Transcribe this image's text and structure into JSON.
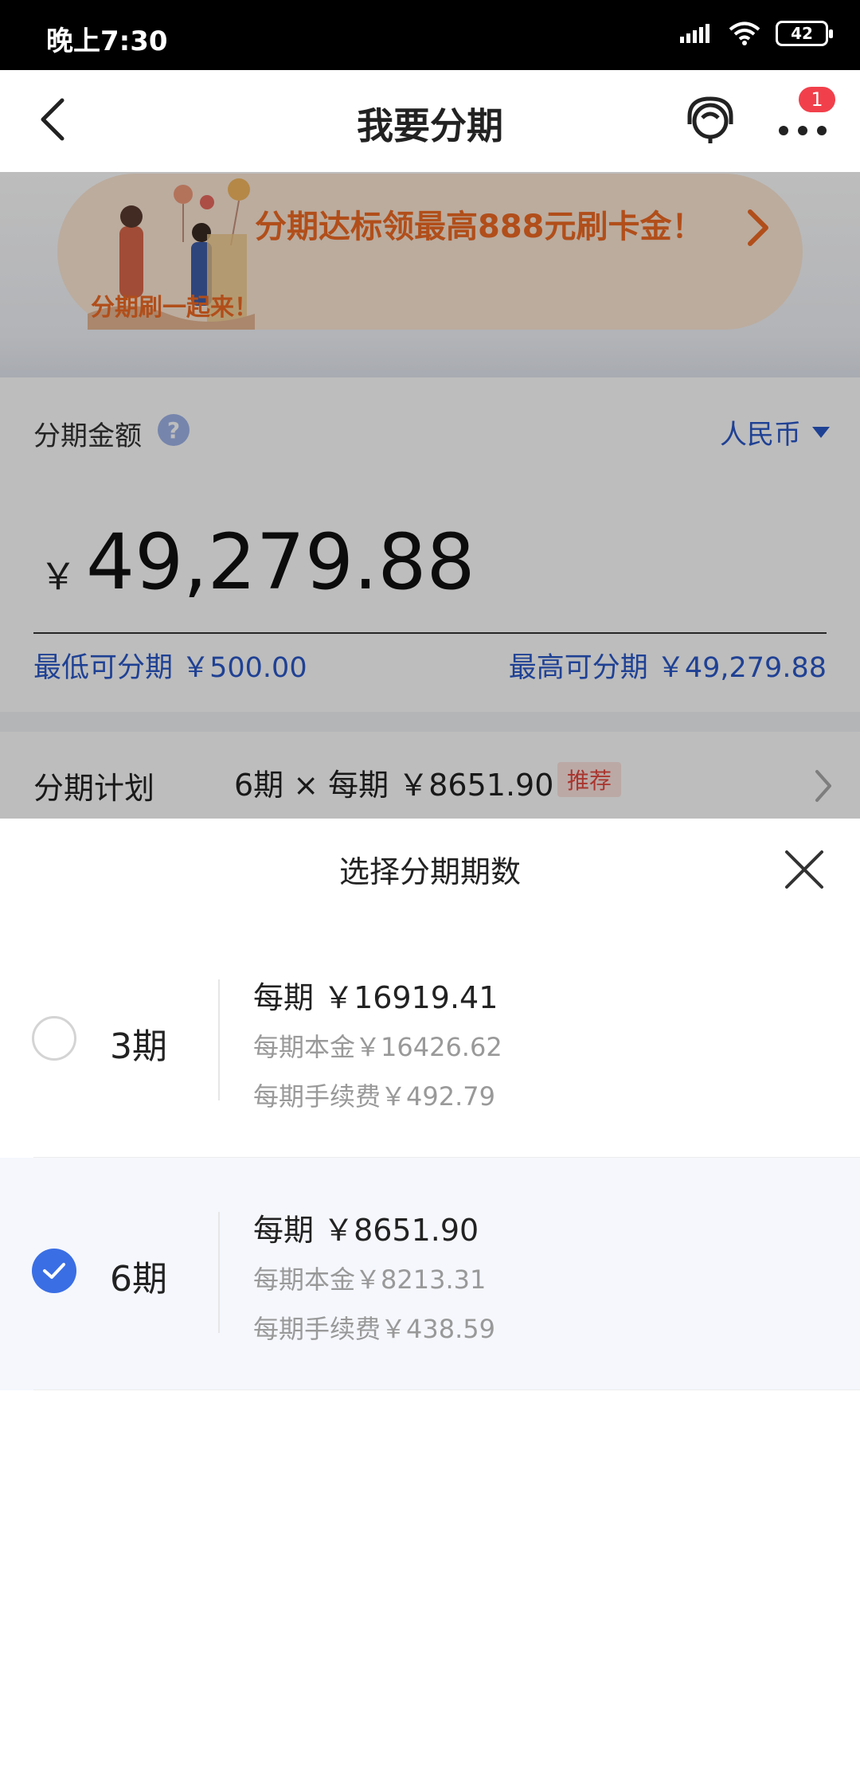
{
  "status_bar": {
    "time": "晚上7:30",
    "battery": "42",
    "icons": [
      "signal-icon",
      "wifi-icon",
      "battery-icon"
    ]
  },
  "nav": {
    "title": "我要分期",
    "badge": "1",
    "icons": [
      "back-icon",
      "customer-service-icon",
      "more-icon"
    ]
  },
  "banner": {
    "text": "分期达标领最高888元刷卡金！",
    "art_text": "分期刷一起来！"
  },
  "amount": {
    "label": "分期金额",
    "help": "?",
    "currency": "人民币",
    "yen": "￥",
    "value": "49,279.88",
    "min_text": "最低可分期 ￥500.00",
    "max_text": "最高可分期 ￥49,279.88"
  },
  "plan": {
    "label": "分期计划",
    "value": "6期 × 每期 ￥8651.90",
    "tag": "推荐"
  },
  "sheet": {
    "title": "选择分期期数",
    "options": [
      {
        "term": "3期",
        "per_period": "每期 ￥16919.41",
        "principal": "每期本金￥16426.62",
        "fee": "每期手续费￥492.79",
        "selected": false
      },
      {
        "term": "6期",
        "per_period": "每期 ￥8651.90",
        "principal": "每期本金￥8213.31",
        "fee": "每期手续费￥438.59",
        "selected": true
      }
    ]
  },
  "colors": {
    "accent_blue": "#2b58c8",
    "radio_checked": "#3a6ee4",
    "banner_orange": "#ef6a24",
    "badge_red": "#f1404b",
    "tag_red": "#e5483e"
  }
}
